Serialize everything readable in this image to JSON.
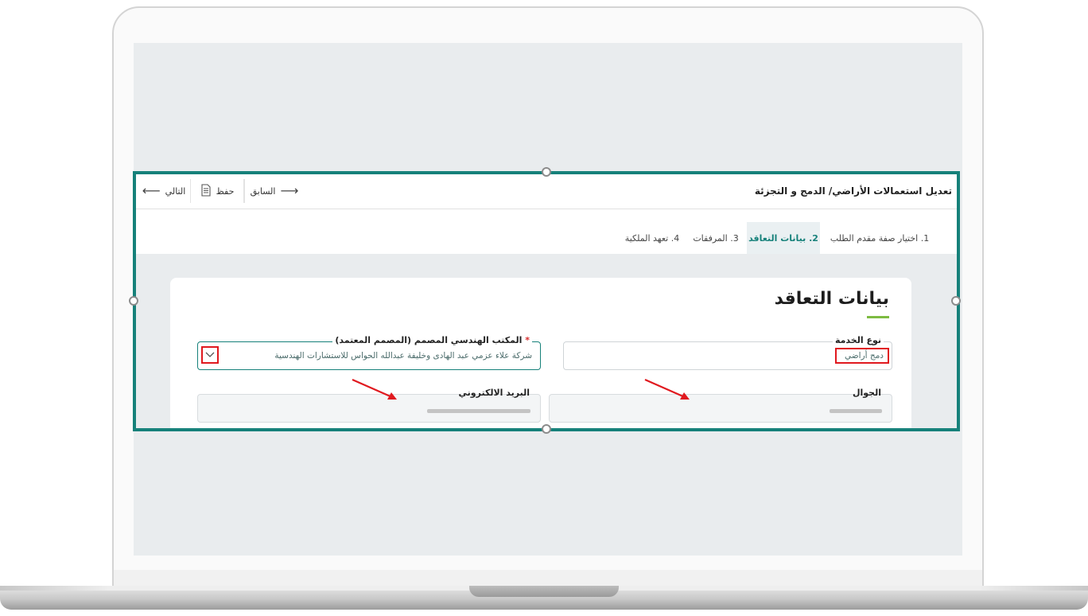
{
  "header": {
    "title": "تعديل استعمالات الأراضي/ الدمج و التجزئة",
    "next_label": "التالي",
    "save_label": "حفظ",
    "prev_label": "السابق"
  },
  "tabs": [
    {
      "label": "1. اختيار صفة مقدم الطلب"
    },
    {
      "label": "2. بيانات التعاقد",
      "active": true
    },
    {
      "label": "3. المرفقات"
    },
    {
      "label": "4. تعهد الملكية"
    }
  ],
  "form": {
    "title": "بيانات التعاقد",
    "service_type": {
      "label": "نوع الخدمة",
      "value": "دمج أراضي"
    },
    "engineering_office": {
      "label": "المكتب الهندسي المصمم (المصمم المعتمد)",
      "required_mark": "*",
      "value": "شركة علاء عزمي عبد الهادى وخليفة عبدالله الحواس للاستشارات الهندسية"
    },
    "mobile": {
      "label": "الجوال"
    },
    "email": {
      "label": "البريد الالكتروني"
    }
  },
  "colors": {
    "frame_border": "#16817a",
    "accent_underline": "#7dbb42",
    "highlight_red": "#e0191f",
    "active_tab_text": "#16817a"
  },
  "icons": {
    "next": "arrow-left-icon",
    "save": "document-icon",
    "prev": "arrow-right-icon",
    "dropdown": "chevron-down-icon"
  }
}
